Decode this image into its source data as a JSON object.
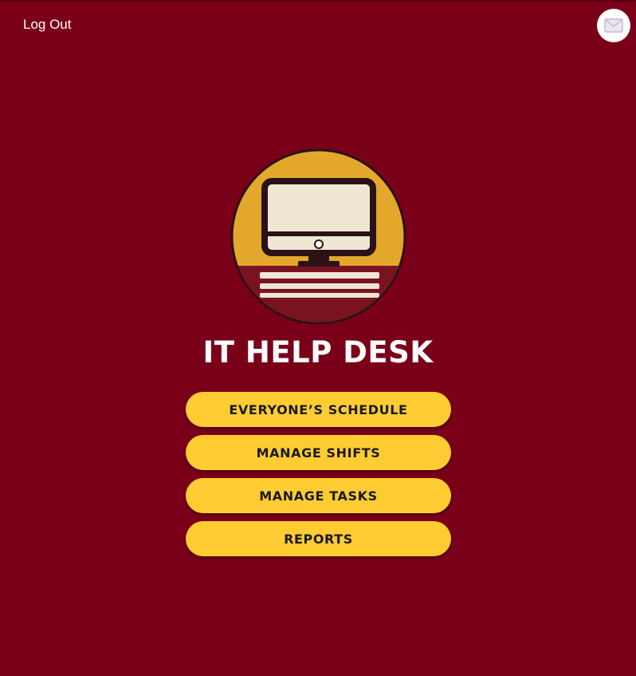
{
  "header": {
    "logout_label": "Log Out",
    "mail_icon": "mail-icon"
  },
  "logo": {
    "icon": "computer-monitor-icon",
    "colors": {
      "circle": "#e3a82b",
      "screen": "#efe6d4",
      "outline": "#2a1216"
    }
  },
  "app": {
    "title": "IT HELP DESK"
  },
  "menu": {
    "items": [
      {
        "label": "EVERYONE’S SCHEDULE"
      },
      {
        "label": "MANAGE SHIFTS"
      },
      {
        "label": "MANAGE TASKS"
      },
      {
        "label": "REPORTS"
      }
    ]
  },
  "theme": {
    "background": "#7a0019",
    "button": "#ffcc33",
    "button_text": "#1a1a1a",
    "title_text": "#ffffff"
  }
}
